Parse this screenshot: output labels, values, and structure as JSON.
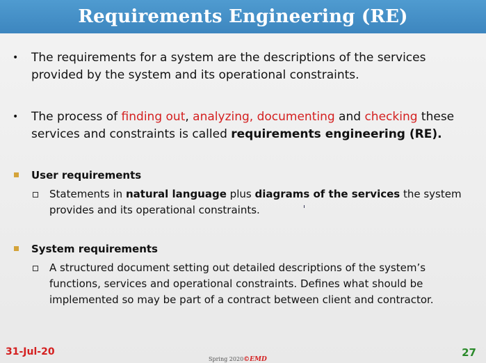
{
  "slide": {
    "title": "Requirements Engineering (RE)",
    "bullets": [
      {
        "symbol": "•",
        "text": "The requirements for a system are the descriptions of the services provided by the system and its operational constraints."
      },
      {
        "symbol": "•",
        "parts": [
          "The process of ",
          "finding out",
          ", ",
          "analyzing, documenting",
          " and ",
          "checking",
          " these services and constraints is called ",
          "requirements engineering (RE)."
        ]
      }
    ],
    "sections": [
      {
        "heading": "User requirements",
        "item_parts": [
          "Statements in ",
          "natural language",
          " plus ",
          "diagrams of the services",
          " the system provides and its operational constraints."
        ]
      },
      {
        "heading": "System requirements",
        "item": "A structured document setting out detailed descriptions of the system’s functions, services and operational constraints. Defines what should be implemented so may be part of a contract between client and contractor."
      }
    ]
  },
  "footer": {
    "date": "31-Jul-20",
    "center_prefix": "Spring 2020",
    "center_mark": "©EMD",
    "page": "27"
  },
  "colors": {
    "title_bar": "#4490c8",
    "highlight_red": "#d42020",
    "section_marker": "#d4a33a",
    "page_number": "#2a8a2a"
  }
}
